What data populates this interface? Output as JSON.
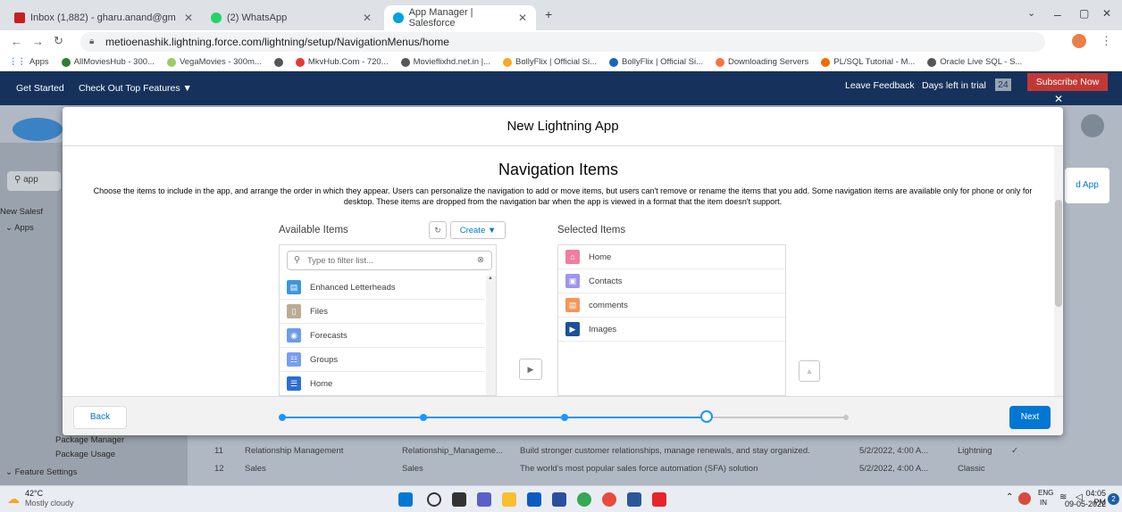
{
  "browser": {
    "tabs": [
      {
        "label": "Inbox (1,882) - gharu.anand@gm",
        "color": "#c5221f"
      },
      {
        "label": "(2) WhatsApp",
        "color": "#25d366"
      },
      {
        "label": "App Manager | Salesforce",
        "color": "#00a1e0"
      }
    ],
    "url": "metioenashik.lightning.force.com/lightning/setup/NavigationMenus/home",
    "bookmarks": [
      "Apps",
      "AllMoviesHub - 300...",
      "VegaMovies - 300m...",
      "MkvHub.Com - 720...",
      "Movieflixhd.net.in |...",
      "BollyFlix | Official Si...",
      "BollyFlix | Official Si...",
      "Downloading Servers",
      "PL/SQL Tutorial - M...",
      "Oracle Live SQL - S..."
    ]
  },
  "sf_strip": {
    "get_started": "Get Started",
    "top_features": "Check Out Top Features ▼",
    "leave_feedback": "Leave Feedback",
    "days_left": "Days left in trial",
    "days_count": "24",
    "subscribe": "Subscribe Now"
  },
  "background": {
    "search_placeholder": "app",
    "new_salesforce": "New Salesf",
    "apps": "Apps",
    "package_manager": "Package Manager",
    "package_usage": "Package Usage",
    "feature_settings": "Feature Settings",
    "new_app_btn": "d App",
    "rows": [
      {
        "num": "11",
        "name": "Relationship Management",
        "dev": "Relationship_Manageme...",
        "desc": "Build stronger customer relationships, manage renewals, and stay organized.",
        "date": "5/2/2022, 4:00 A...",
        "type": "Lightning",
        "check": "✓"
      },
      {
        "num": "12",
        "name": "Sales",
        "dev": "Sales",
        "desc": "The world's most popular sales force automation (SFA) solution",
        "date": "5/2/2022, 4:00 A...",
        "type": "Classic",
        "check": ""
      }
    ]
  },
  "modal": {
    "title": "New Lightning App",
    "section_title": "Navigation Items",
    "description": "Choose the items to include in the app, and arrange the order in which they appear. Users can personalize the navigation to add or move items, but users can't remove or rename the items that you add. Some navigation items are available only for phone or only for desktop. These items are dropped from the navigation bar when the app is viewed in a format that the item doesn't support.",
    "available_label": "Available Items",
    "create_label": "Create ▼",
    "filter_placeholder": "Type to filter list...",
    "selected_label": "Selected Items",
    "available_items": [
      {
        "label": "Enhanced Letterheads",
        "color": "#3c97dd",
        "icon": "▤"
      },
      {
        "label": "Files",
        "color": "#baac93",
        "icon": "▯"
      },
      {
        "label": "Forecasts",
        "color": "#6b9ee8",
        "icon": "◉"
      },
      {
        "label": "Groups",
        "color": "#779ef2",
        "icon": "☷"
      },
      {
        "label": "Home",
        "color": "#2d6ed4",
        "icon": "☰"
      }
    ],
    "selected_items": [
      {
        "label": "Home",
        "color": "#ef7ea0",
        "icon": "⌂"
      },
      {
        "label": "Contacts",
        "color": "#a094ed",
        "icon": "▣"
      },
      {
        "label": "comments",
        "color": "#f49756",
        "icon": "▤"
      },
      {
        "label": "Images",
        "color": "#1b5297",
        "icon": "▶"
      }
    ],
    "back_label": "Back",
    "next_label": "Next"
  },
  "taskbar": {
    "weather_temp": "42°C",
    "weather_desc": "Mostly cloudy",
    "lang": "ENG",
    "region": "IN",
    "time": "04:05 PM",
    "date": "09-05-2022"
  }
}
